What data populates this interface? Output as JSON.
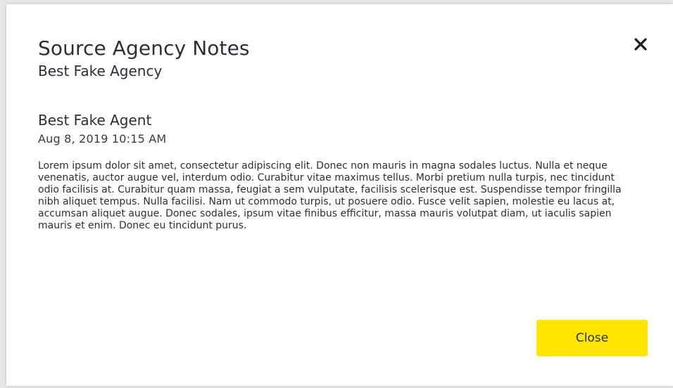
{
  "modal": {
    "title": "Source Agency Notes",
    "agency_name": "Best Fake Agency",
    "close_icon": "close-icon"
  },
  "note": {
    "author": "Best Fake Agent",
    "timestamp": "Aug 8, 2019 10:15 AM",
    "body": "Lorem ipsum dolor sit amet, consectetur adipiscing elit. Donec non mauris in magna sodales luctus. Nulla et neque venenatis, auctor augue vel, interdum odio. Curabitur vitae maximus tellus. Morbi pretium nulla turpis, nec tincidunt odio facilisis at. Curabitur quam massa, feugiat a sem vulputate, facilisis scelerisque est. Suspendisse tempor fringilla nibh aliquet tempus. Nulla facilisi. Nam ut commodo turpis, ut posuere odio. Fusce velit sapien, molestie eu lacus at, accumsan aliquet augue. Donec sodales, ipsum vitae finibus efficitur, massa mauris volutpat diam, ut iaculis sapien mauris et enim. Donec eu tincidunt purus."
  },
  "footer": {
    "close_label": "Close"
  },
  "colors": {
    "accent": "#ffe600",
    "text": "#2e2e38",
    "backdrop": "#e6e7e8"
  }
}
